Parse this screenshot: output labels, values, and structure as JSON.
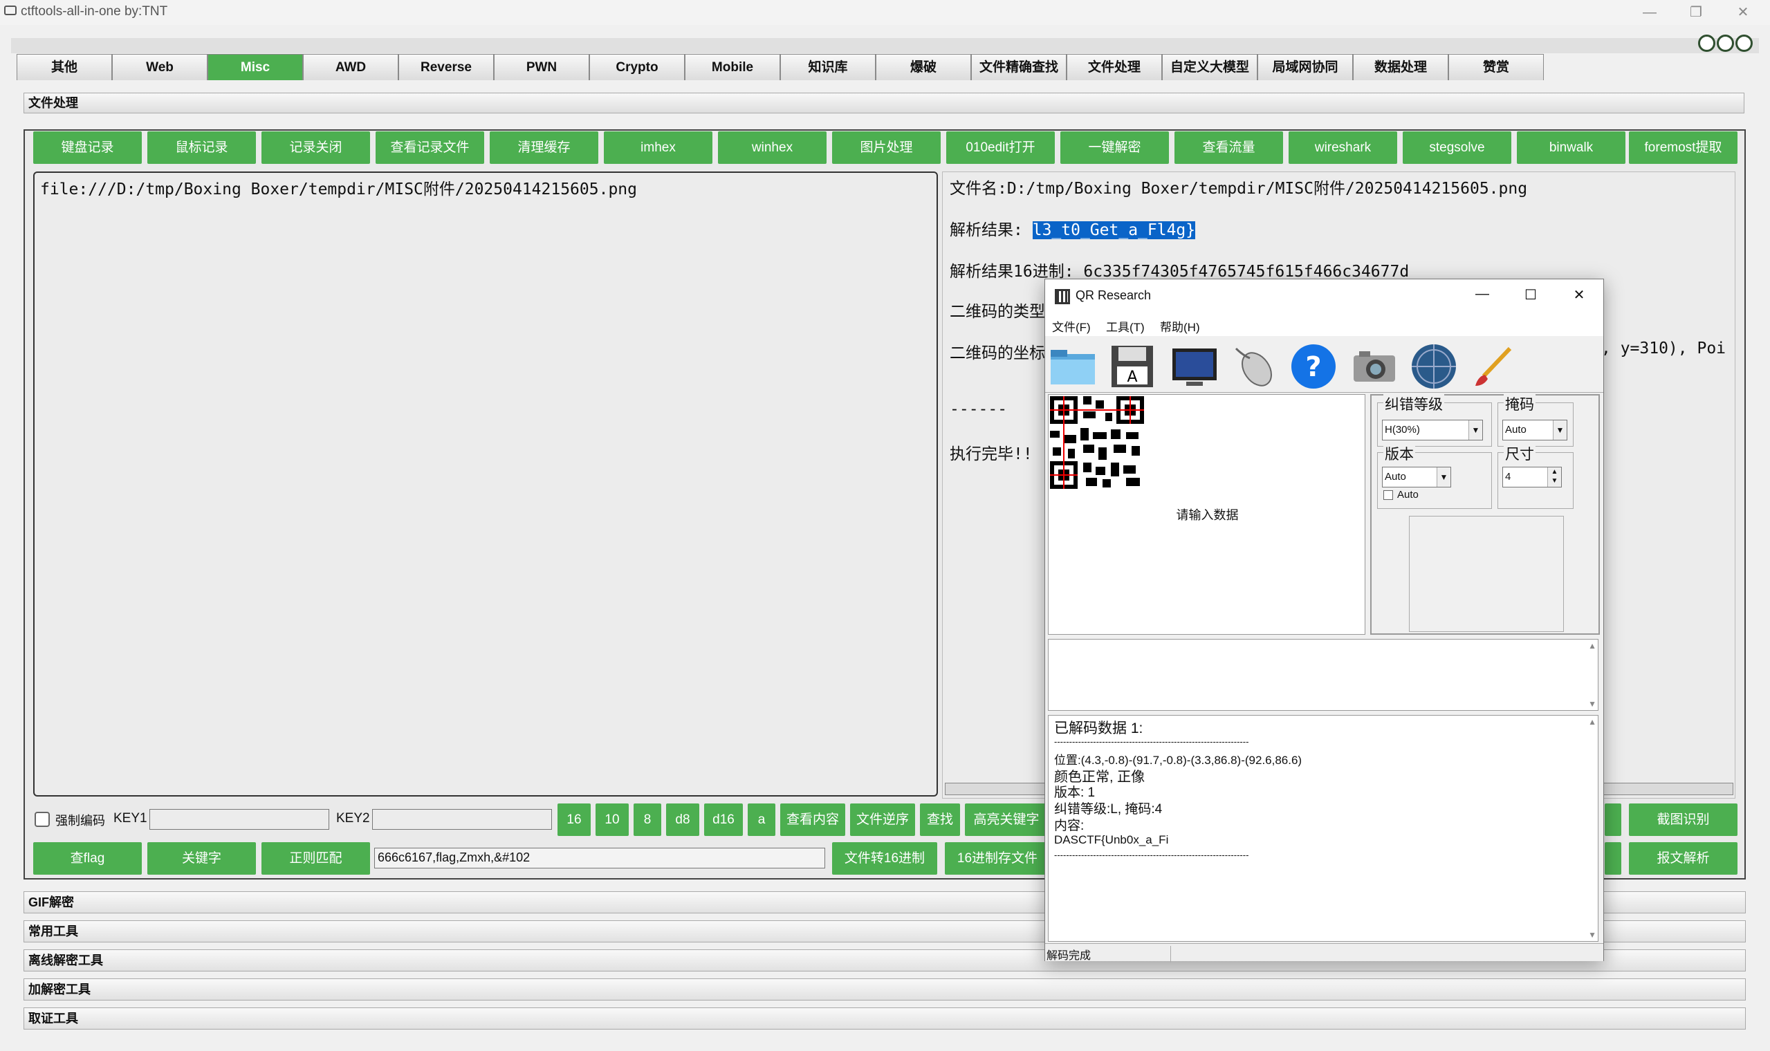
{
  "window": {
    "title": "ctftools-all-in-one   by:TNT",
    "minimize": "—",
    "restore": "❐",
    "close": "✕"
  },
  "tabs": [
    "其他",
    "Web",
    "Misc",
    "AWD",
    "Reverse",
    "PWN",
    "Crypto",
    "Mobile",
    "知识库",
    "爆破",
    "文件精确查找",
    "文件处理",
    "自定义大模型",
    "局域网协同",
    "数据处理",
    "赞赏"
  ],
  "active_tab": "Misc",
  "section_title": "文件处理",
  "toolbar_buttons": [
    "键盘记录",
    "鼠标记录",
    "记录关闭",
    "查看记录文件",
    "清理缓存",
    "imhex",
    "winhex",
    "图片处理",
    "010edit打开",
    "一键解密",
    "查看流量",
    "wireshark",
    "stegsolve",
    "binwalk",
    "foremost提取"
  ],
  "left_text": "file:///D:/tmp/Boxing Boxer/tempdir/MISC附件/20250414215605.png",
  "right_lines": {
    "filename": "文件名:D:/tmp/Boxing Boxer/tempdir/MISC附件/20250414215605.png",
    "result_label": "解析结果:",
    "result_value": "l3_t0_Get_a_Fl4g}",
    "hex_result": "解析结果16进制: 6c335f74305f4765745f615f466c34677d",
    "qr_type": "二维码的类型",
    "qr_coords": "二维码的坐标",
    "coord_tail": ", y=310), Poi",
    "divider": "------",
    "done": "执行完毕!!"
  },
  "options": {
    "force_encoding": "强制编码",
    "key1": "KEY1",
    "key2": "KEY2"
  },
  "row1_buttons": [
    "16",
    "10",
    "8",
    "d8",
    "d16",
    "a",
    "查看内容",
    "文件逆序",
    "查找",
    "高亮关键字"
  ],
  "row1_right_button": "截图识别",
  "row2_buttons": [
    "查flag",
    "关键字",
    "正则匹配"
  ],
  "search_value": "666c6167,flag,Zmxh,&#102",
  "row2_mid_buttons": [
    "文件转16进制",
    "16进制存文件"
  ],
  "row2_right_button": "报文解析",
  "accordion": [
    "GIF解密",
    "常用工具",
    "离线解密工具",
    "加解密工具",
    "取证工具"
  ],
  "qr_window": {
    "title": "QR Research",
    "menu": [
      "文件(F)",
      "工具(T)",
      "帮助(H)"
    ],
    "toolbar_icons": [
      "folder-icon",
      "save-icon",
      "monitor-icon",
      "mouse-icon",
      "help-icon",
      "camera-icon",
      "globe-icon",
      "brush-icon"
    ],
    "placeholder": "请输入数据",
    "settings": {
      "ecc_label": "纠错等级",
      "ecc_value": "H(30%)",
      "mask_label": "掩码",
      "mask_value": "Auto",
      "version_label": "版本",
      "version_value": "Auto",
      "auto_checkbox": "Auto",
      "size_label": "尺寸",
      "size_value": "4"
    },
    "output": {
      "header": "已解码数据 1:",
      "divider": "-----------------------------------------------------------------",
      "position": "位置:(4.3,-0.8)-(91.7,-0.8)-(3.3,86.8)-(92.6,86.6)",
      "color": "颜色正常, 正像",
      "version": "版本: 1",
      "ecc": "纠错等级:L, 掩码:4",
      "content_label": "内容:",
      "content": "DASCTF{Unb0x_a_Fi",
      "divider2": "-----------------------------------------------------------------"
    },
    "status": "解码完成"
  }
}
